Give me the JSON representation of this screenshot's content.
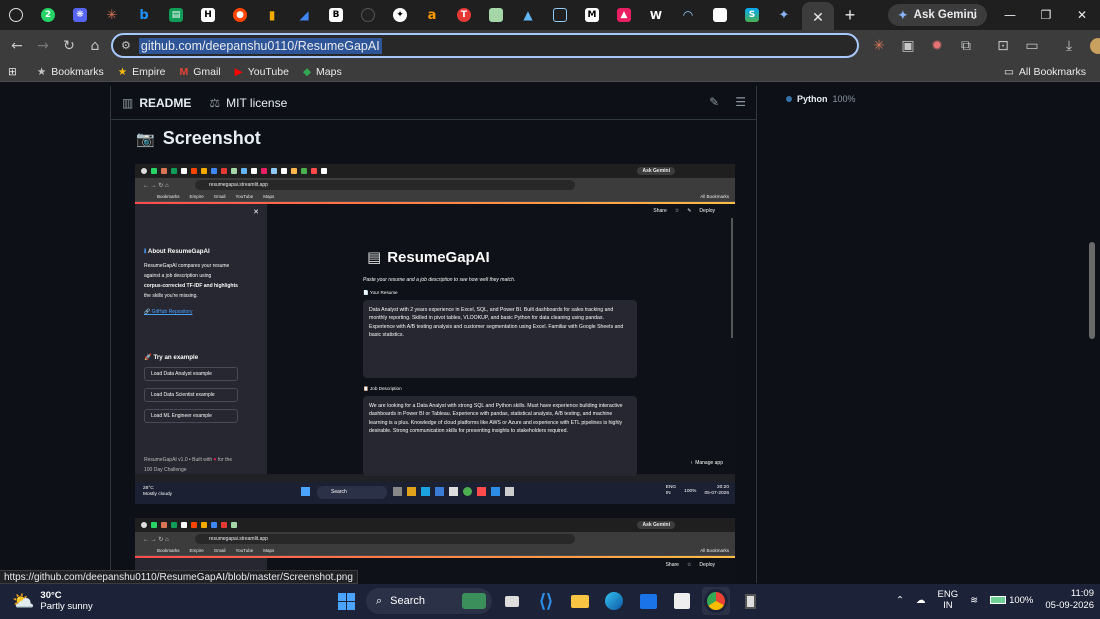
{
  "browser": {
    "gemini_label": "Ask Gemini",
    "url": "github.com/deepanshu0110/ResumeGapAI",
    "bookmarks": [
      "Bookmarks",
      "Empire",
      "Gmail",
      "YouTube",
      "Maps"
    ],
    "all_bookmarks": "All Bookmarks",
    "status_url": "https://github.com/deepanshu0110/ResumeGapAI/blob/master/Screenshot.png"
  },
  "readme": {
    "tab_readme": "README",
    "tab_license": "MIT license",
    "heading": "Screenshot"
  },
  "languages": {
    "name": "Python",
    "percent": "100%"
  },
  "shot": {
    "url": "resumegapai.streamlit.app",
    "gemini": "Ask Gemini",
    "bookmarks": [
      "Bookmarks",
      "Empire",
      "Gmail",
      "YouTube",
      "Maps"
    ],
    "all_bookmarks": "All Bookmarks",
    "header": [
      "Share",
      "Deploy"
    ],
    "sidebar": {
      "about_title": "About ResumeGapAI",
      "about_text_1": "ResumeGapAI compares your resume",
      "about_text_2": "against a job description using",
      "about_text_3": "corpus-corrected TF-IDF and highlights",
      "about_text_4": "the skills you're missing.",
      "repo_link": "GitHub Repository",
      "try_title": "Try an example",
      "btn1": "Load Data Analyst example",
      "btn2": "Load Data Scientist example",
      "btn3": "Load ML Engineer example",
      "footer_1": "ResumeGapAI v1.0 • Built with",
      "footer_2": "for the",
      "footer_3": "100 Day Challenge"
    },
    "main": {
      "title": "ResumeGapAI",
      "caption": "Paste your resume and a job description to see how well they match.",
      "resume_label": "Your Resume",
      "resume_text": "Data Analyst with 2 years experience in Excel, SQL, and Power BI. Built dashboards for sales tracking and monthly reporting. Skilled in pivot tables, VLOOKUP, and basic Python for data cleaning using pandas. Experience with A/B testing analysis and customer segmentation using Excel. Familiar with Google Sheets and basic statistics.",
      "jd_label": "Job Description",
      "jd_text": "We are looking for a Data Analyst with strong SQL and Python skills. Must have experience building interactive dashboards in Power BI or Tableau. Experience with pandas, statistical analysis, A/B testing, and machine learning is a plus. Knowledge of cloud platforms like AWS or Azure and experience with ETL pipelines is highly desirable. Strong communication skills for presenting insights to stakeholders required.",
      "manage_app": "Manage app"
    },
    "taskbar": {
      "temp": "28°C",
      "weather": "Mostly cloudy",
      "search": "Search",
      "lang1": "ENG",
      "lang2": "IN",
      "battery": "100%",
      "time": "20:20",
      "date": "05-07-2026"
    }
  },
  "taskbar": {
    "temp": "30°C",
    "weather": "Partly sunny",
    "search": "Search",
    "lang1": "ENG",
    "lang2": "IN",
    "battery": "100%",
    "time": "11:09",
    "date": "05-09-2026"
  },
  "colors": {
    "accent": "#a8c7fa",
    "language_python": "#3572a5",
    "streamlit_red": "#ff4b4b"
  }
}
